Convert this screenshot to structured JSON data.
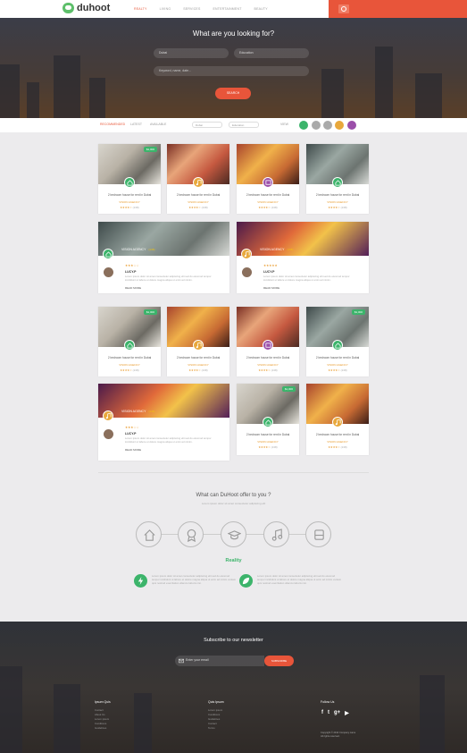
{
  "brand": {
    "name": "duhoot"
  },
  "nav": [
    "REALTY",
    "LIVING",
    "SERVICES",
    "ENTERTAINMENT",
    "BEAUTY"
  ],
  "hero": {
    "title": "What are you looking for?",
    "city": "Dubai",
    "category": "Education",
    "keyword_placeholder": "Keyword, name, date...",
    "search_label": "SEARCH"
  },
  "filter": {
    "tabs": [
      "RECOMMENDED",
      "LATEST",
      "AVAILABLE"
    ],
    "sort1": "Dubai",
    "sort2": "Education",
    "view_label": "VIEW"
  },
  "cards": {
    "title": "2 bedroom house for rent in Dubai",
    "agency": "VISION AGENCY",
    "rating": "★★★★☆",
    "reviews": "(138)",
    "price": "$1,000",
    "banner_agency": "VISION AGENCY",
    "banner_reviews": "(138)",
    "reviewer": "LUCY.P",
    "review_text": "Lorem ipsum dolor sit amet consectetur adipiscing elit sed do eiusmod tempor incididunt ut labore et dolore magna aliqua ut enim ad minim.",
    "read_more": "READ MORE",
    "review_stars": "★★★☆☆",
    "review_stars_alt": "★★★★★"
  },
  "offer": {
    "title": "What can DuHoot offer to you ?",
    "subtitle": "Lorem ipsum dolor sit amet consectetur adipiscing elit",
    "icons": [
      "home-icon",
      "award-icon",
      "graduation-icon",
      "music-icon",
      "bus-icon"
    ],
    "reality": "Reality",
    "features": [
      "Lorem ipsum dolor sit amet consectetur adipiscing elit sed do eiusmod tempor incididunt ut labore et dolore magna aliqua ut enim ad minim veniam quis nostrud exercitation ullamco laboris nisi.",
      "Lorem ipsum dolor sit amet consectetur adipiscing elit sed do eiusmod tempor incididunt ut labore et dolore magna aliqua ut enim ad minim veniam quis nostrud exercitation ullamco laboris nisi."
    ]
  },
  "footer": {
    "newsletter": "Subscribe to our newsletter",
    "email_placeholder": "Enter your email",
    "subscribe": "SUBSCRIBE",
    "col1_title": "Ipsum Quis",
    "col1": [
      "Contact",
      "About Us",
      "Lorem ipsum",
      "Conditions",
      "Guidelines"
    ],
    "col2_title": "Quis Ipsum",
    "col2": [
      "Lorem ipsum",
      "Conditions",
      "Guidelines",
      "Contact",
      "Terms"
    ],
    "follow": "Follow Us",
    "copyright": "Copyright © 2014 Company name",
    "rights": "All rights reserved.",
    "accent": "#e8553a",
    "green": "#3cb46b"
  }
}
